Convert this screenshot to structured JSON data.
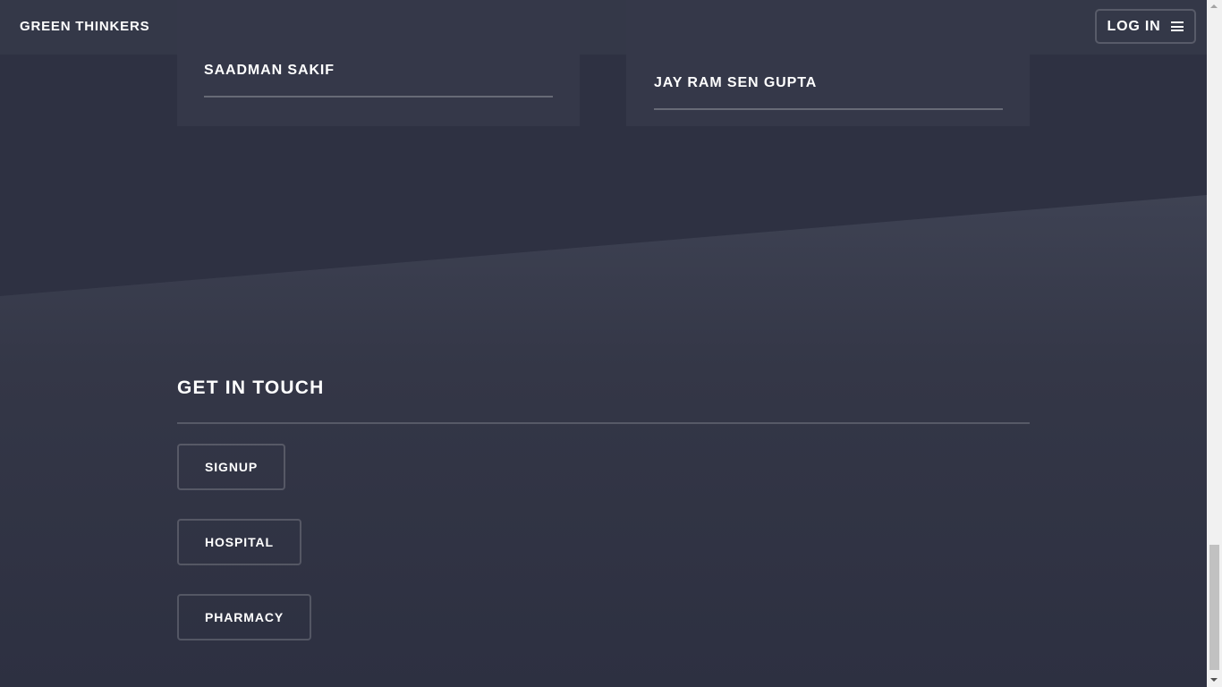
{
  "header": {
    "brand": "GREEN THINKERS",
    "login_label": "LOG IN",
    "menu_icon": "hamburger-menu-icon"
  },
  "team": {
    "members": [
      {
        "name": "SAADMAN SAKIF"
      },
      {
        "name": "JAY RAM SEN GUPTA"
      }
    ]
  },
  "contact": {
    "title": "GET IN TOUCH",
    "buttons": [
      {
        "label": "SIGNUP"
      },
      {
        "label": "HOSPITAL"
      },
      {
        "label": "PHARMACY"
      }
    ]
  },
  "colors": {
    "background": "#2e3142",
    "header": "#353849",
    "card": "#353849",
    "text": "#ffffff"
  }
}
